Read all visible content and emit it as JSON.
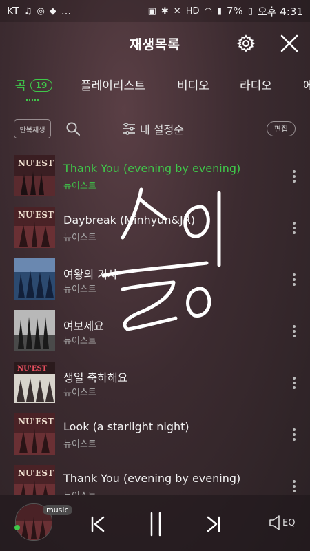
{
  "status_bar": {
    "carrier": "KT",
    "battery": "7%",
    "time": "오후 4:31",
    "dots": "..."
  },
  "header": {
    "title": "재생목록",
    "icons": [
      "gear-icon",
      "close-icon"
    ]
  },
  "tabs": [
    {
      "label": "곡",
      "count": "19",
      "active": true
    },
    {
      "label": "플레이리스트",
      "active": false
    },
    {
      "label": "비디오",
      "active": false
    },
    {
      "label": "라디오",
      "active": false
    },
    {
      "label": "에",
      "active": false
    }
  ],
  "toolbar": {
    "repeat_label": "반복재생",
    "sort_label": "내 설정순",
    "edit_label": "편집"
  },
  "songs": [
    {
      "title": "Thank You (evening by evening)",
      "artist": "뉴이스트",
      "playing": true
    },
    {
      "title": "Daybreak (Minhyun&JR)",
      "artist": "뉴이스트",
      "playing": false
    },
    {
      "title": "여왕의 기사",
      "artist": "뉴이스트",
      "playing": false
    },
    {
      "title": "여보세요",
      "artist": "뉴이스트",
      "playing": false
    },
    {
      "title": "생일 축하해요",
      "artist": "뉴이스트",
      "playing": false
    },
    {
      "title": "Look (a starlight night)",
      "artist": "뉴이스트",
      "playing": false
    },
    {
      "title": "Thank You (evening by evening)",
      "artist": "뉴이스트",
      "playing": false
    }
  ],
  "player": {
    "badge": "music",
    "eq_label": "EQ"
  },
  "colors": {
    "accent": "#3fc84a",
    "background": "#3c2b30"
  }
}
